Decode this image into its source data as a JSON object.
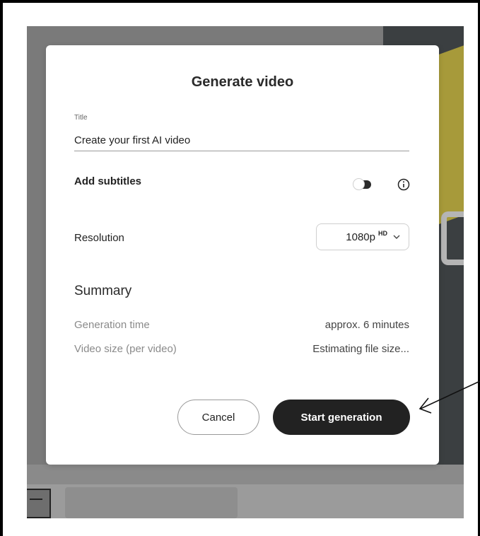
{
  "dialog": {
    "title": "Generate video",
    "title_field_label": "Title",
    "title_field_value": "Create your first AI video",
    "subtitles_label": "Add subtitles",
    "subtitles_enabled": false,
    "resolution_label": "Resolution",
    "resolution_value": "1080p",
    "resolution_badge": "HD",
    "summary_heading": "Summary",
    "summary": [
      {
        "key": "Generation time",
        "value": "approx. 6 minutes"
      },
      {
        "key": "Video size (per video)",
        "value": "Estimating file size..."
      }
    ],
    "cancel_label": "Cancel",
    "start_label": "Start generation"
  },
  "icons": {
    "info": "info-icon",
    "chevron": "chevron-down-icon",
    "annotation": "arrow-annotation-icon"
  },
  "colors": {
    "primary_button": "#222222",
    "backdrop": "#7a7a7a",
    "accent_yellow": "#a79a3a"
  }
}
